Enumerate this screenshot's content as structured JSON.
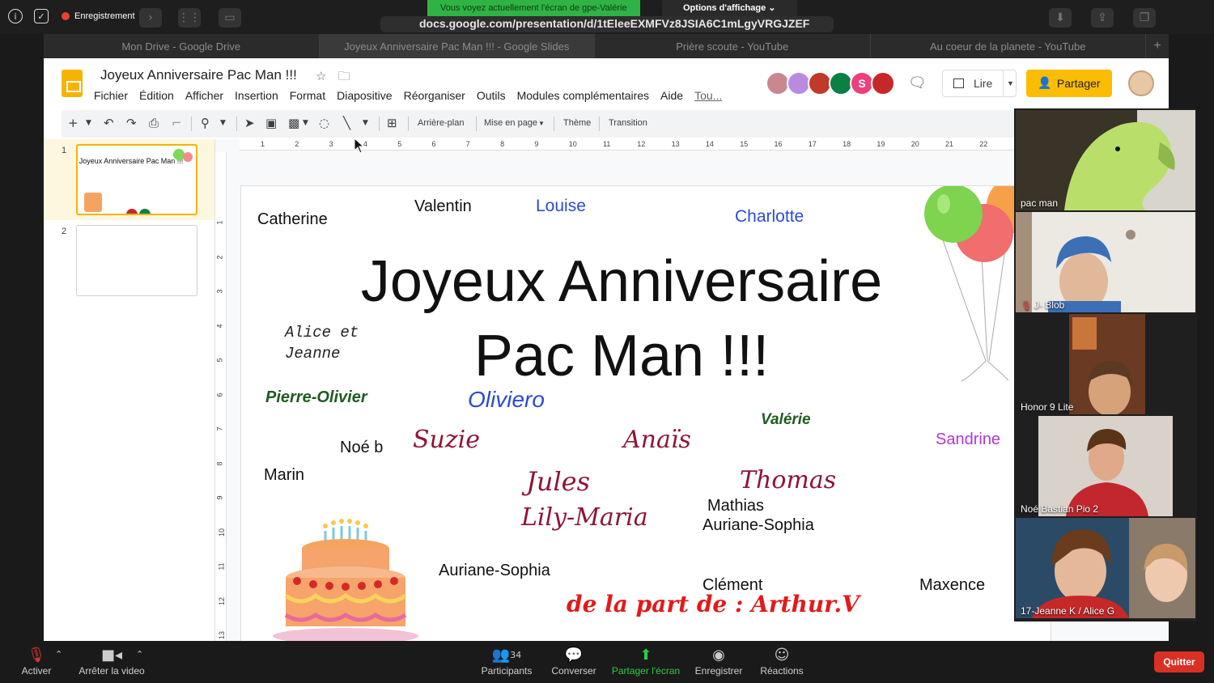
{
  "zoom": {
    "recording_label": "Enregistrement",
    "share_banner": "Vous voyez actuellement l'écran de gpe-Valérie",
    "view_options": "Options d'affichage",
    "bottom_bar": {
      "unmute": "Activer",
      "stop_video": "Arrêter la video",
      "participants": "Participants",
      "participants_count": "34",
      "chat": "Converser",
      "share_screen": "Partager l'écran",
      "record": "Enregistrer",
      "reactions": "Réactions",
      "quit": "Quitter"
    },
    "gallery": [
      {
        "name": "pac man"
      },
      {
        "name": "J- Blob"
      },
      {
        "name": "Honor 9 Lite"
      },
      {
        "name": "Noé Bastian Pio 2"
      },
      {
        "name": "17-Jeanne K / Alice G"
      }
    ]
  },
  "browser": {
    "url": "docs.google.com/presentation/d/1tEleeEXMFVz8JSIA6C1mLgyVRGJZEF",
    "tabs": [
      {
        "title": "Mon Drive - Google Drive",
        "active": false
      },
      {
        "title": "Joyeux Anniversaire Pac Man !!! - Google Slides",
        "active": true
      },
      {
        "title": "Prière scoute - YouTube",
        "active": false
      },
      {
        "title": "Au coeur de la planete - YouTube",
        "active": false
      }
    ],
    "new_tab": "+"
  },
  "slides": {
    "doc_title": "Joyeux Anniversaire  Pac Man !!!",
    "menu": [
      "Fichier",
      "Édition",
      "Afficher",
      "Insertion",
      "Format",
      "Diapositive",
      "Réorganiser",
      "Outils",
      "Modules complémentaires",
      "Aide"
    ],
    "menu_last": "Tou...",
    "present_label": "Lire",
    "share_label": "Partager",
    "collaborator_initial": "S",
    "toolbar": {
      "background": "Arrière-plan",
      "layout": "Mise en page",
      "theme": "Thème",
      "transition": "Transition"
    },
    "filmstrip": [
      {
        "number": "1",
        "thumb_title": "Joyeux Anniversaire Pac Man !!!"
      },
      {
        "number": "2"
      }
    ],
    "ruler_h": [
      "1",
      "2",
      "3",
      "4",
      "5",
      "6",
      "7",
      "8",
      "9",
      "10",
      "11",
      "12",
      "13",
      "14",
      "15",
      "16",
      "17",
      "18",
      "19",
      "20",
      "21",
      "22"
    ],
    "ruler_v": [
      "1",
      "2",
      "3",
      "4",
      "5",
      "6",
      "7",
      "8",
      "9",
      "10",
      "11",
      "12",
      "13"
    ],
    "slide": {
      "title_line1": "Joyeux Anniversaire",
      "title_line2": "Pac Man !!!",
      "names": [
        {
          "text": "Catherine"
        },
        {
          "text": "Valentin"
        },
        {
          "text": "Louise"
        },
        {
          "text": "Charlotte"
        },
        {
          "text": "Alice et"
        },
        {
          "text": "Jeanne"
        },
        {
          "text": "Pierre-Olivier"
        },
        {
          "text": "Oliviero"
        },
        {
          "text": "Valérie"
        },
        {
          "text": "Sandrine"
        },
        {
          "text": "Noé b"
        },
        {
          "text": "Suzie"
        },
        {
          "text": "Anaïs"
        },
        {
          "text": "Marin"
        },
        {
          "text": "Jules"
        },
        {
          "text": "Thomas"
        },
        {
          "text": "Lily-Maria"
        },
        {
          "text": "Mathias"
        },
        {
          "text": "Auriane-Sophia"
        },
        {
          "text": "Auriane-Sophia"
        },
        {
          "text": "Clément"
        },
        {
          "text": "Maxence"
        },
        {
          "text": "de la part de : Arthur.V"
        }
      ]
    }
  },
  "colors": {
    "zoom_green": "#2fb344",
    "slides_yellow": "#fbbc04",
    "quit_red": "#d93025",
    "name_blue": "#2b4bd6",
    "name_darkred": "#8e1535",
    "name_green": "#1f5b1f",
    "name_purple": "#b136d8",
    "signature_red": "#e01b1b"
  }
}
